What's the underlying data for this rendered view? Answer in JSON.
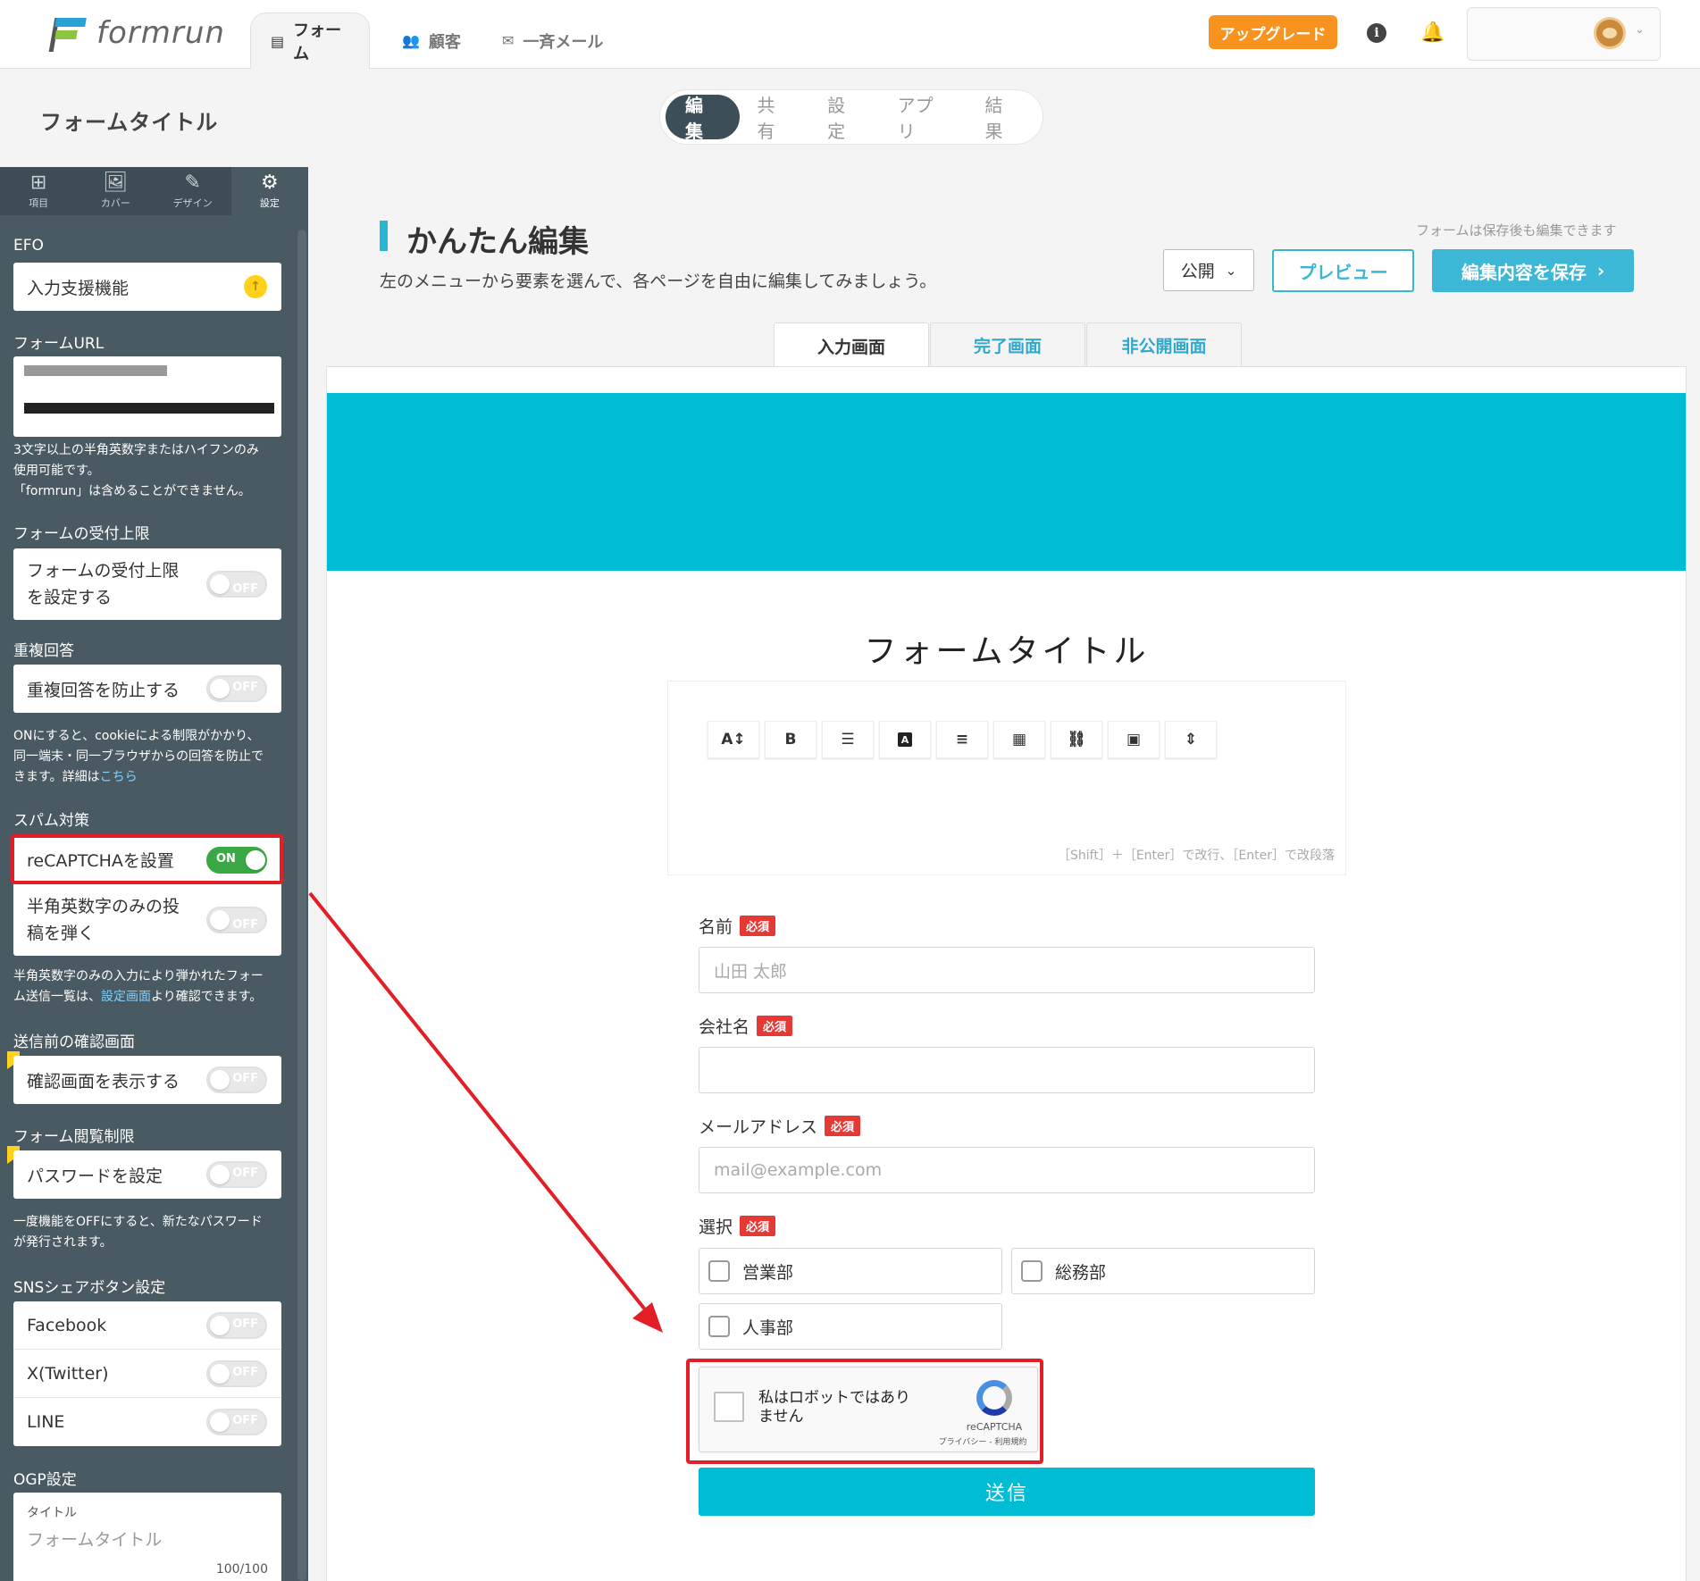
{
  "nav": {
    "logo_text": "formrun",
    "tabs": [
      {
        "label": "フォーム",
        "icon": "document-icon"
      },
      {
        "label": "顧客",
        "icon": "users-icon"
      },
      {
        "label": "一斉メール",
        "icon": "mail-icon"
      }
    ],
    "upgrade_label": "アップグレード",
    "info_glyph": "i",
    "bell_glyph": "🔔"
  },
  "page": {
    "title": "フォームタイトル",
    "segments": [
      "編集",
      "共有",
      "設定",
      "アプリ",
      "結果"
    ]
  },
  "sidebar": {
    "icon_tabs": [
      {
        "label": "項目",
        "glyph": "⊞"
      },
      {
        "label": "カバー",
        "glyph": "🖼"
      },
      {
        "label": "デザイン",
        "glyph": "✎"
      },
      {
        "label": "設定",
        "glyph": "⚙"
      }
    ],
    "efo_label": "EFO",
    "efo_item": "入力支援機能",
    "efo_badge": "↑",
    "url_label": "フォームURL",
    "url_note_1": "3文字以上の半角英数字またはハイフンのみ",
    "url_note_2": "使用可能です。",
    "url_note_3": "「formrun」は含めることができません。",
    "limit_label": "フォームの受付上限",
    "limit_item_1": "フォームの受付上限",
    "limit_item_2": "を設定する",
    "dup_label": "重複回答",
    "dup_item": "重複回答を防止する",
    "dup_note_1": "ONにすると、cookieによる制限がかかり、",
    "dup_note_2": "同一端末・同一ブラウザからの回答を防止で",
    "dup_note_3": "きます。詳細は",
    "dup_note_link": "こちら",
    "spam_label": "スパム対策",
    "recaptcha_item": "reCAPTCHAを設置",
    "alnum_item_1": "半角英数字のみの投",
    "alnum_item_2": "稿を弾く",
    "alnum_note_1": "半角英数字のみの入力により弾かれたフォー",
    "alnum_note_2a": "ム送信一覧は、",
    "alnum_note_link": "設定画面",
    "alnum_note_2b": "より確認できます。",
    "confirm_label": "送信前の確認画面",
    "confirm_item": "確認画面を表示する",
    "access_label": "フォーム閲覧制限",
    "access_item": "パスワードを設定",
    "access_note_1": "一度機能をOFFにすると、新たなパスワード",
    "access_note_2": "が発行されます。",
    "sns_label": "SNSシェアボタン設定",
    "sns_items": [
      "Facebook",
      "X(Twitter)",
      "LINE"
    ],
    "ogp_label": "OGP設定",
    "ogp_title_label": "タイトル",
    "ogp_title_placeholder": "フォームタイトル",
    "ogp_count": "100/100",
    "toggle_on": "ON",
    "toggle_off": "OFF"
  },
  "main": {
    "title": "かんたん編集",
    "subtitle": "左のメニューから要素を選んで、各ページを自由に編集してみましょう。",
    "save_note": "フォームは保存後も編集できます",
    "publish_label": "公開",
    "preview_label": "プレビュー",
    "save_label": "編集内容を保存",
    "page_tabs": [
      "入力画面",
      "完了画面",
      "非公開画面"
    ]
  },
  "form": {
    "title": "フォームタイトル",
    "editor_toolbar": [
      "A↕",
      "B",
      "☰",
      "A",
      "≡",
      "▦",
      "⛓",
      "▣",
      "⇕"
    ],
    "editor_hint": "［Shift］＋［Enter］で改行、［Enter］で改段落",
    "required_label": "必須",
    "fields": [
      {
        "label": "名前",
        "placeholder": "山田 太郎"
      },
      {
        "label": "会社名",
        "placeholder": ""
      },
      {
        "label": "メールアドレス",
        "placeholder": "mail@example.com"
      }
    ],
    "select_label": "選択",
    "options": [
      "営業部",
      "総務部",
      "人事部"
    ],
    "recaptcha_text_1": "私はロボットではあり",
    "recaptcha_text_2": "ません",
    "recaptcha_brand": "reCAPTCHA",
    "recaptcha_links": "プライバシー - 利用規約",
    "submit_label": "送信"
  },
  "colors": {
    "accent": "#00bcd4",
    "sidebar": "#4a5a62",
    "highlight": "#e21f26",
    "upgrade": "#f7931e"
  }
}
